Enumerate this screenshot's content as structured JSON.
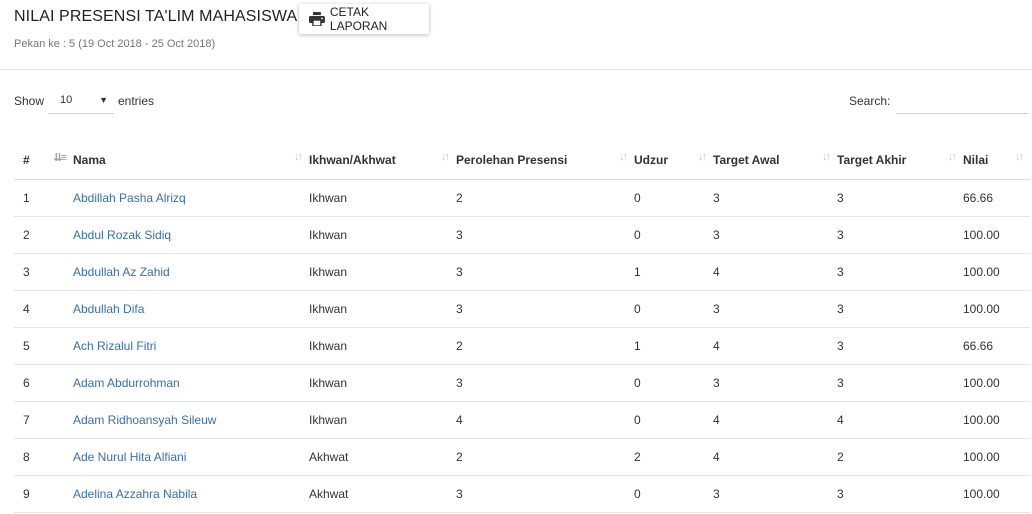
{
  "header": {
    "title": "NILAI PRESENSI TA'LIM MAHASISWA",
    "print_button": "CETAK LAPORAN",
    "print_icon": "printer-icon",
    "subtitle": "Pekan ke : 5 (19 Oct 2018 - 25 Oct 2018)"
  },
  "controls": {
    "show_label": "Show",
    "length_value": "10",
    "entries_label": "entries",
    "search_label": "Search:",
    "search_value": ""
  },
  "table": {
    "columns": [
      "#",
      "Nama",
      "Ikhwan/Akhwat",
      "Perolehan Presensi",
      "Udzur",
      "Target Awal",
      "Target Akhir",
      "Nilai"
    ],
    "sort_icon": "sort-arrows-icon",
    "rows": [
      [
        "1",
        "Abdillah Pasha Alrizq",
        "Ikhwan",
        "2",
        "0",
        "3",
        "3",
        "66.66"
      ],
      [
        "2",
        "Abdul Rozak Sidiq",
        "Ikhwan",
        "3",
        "0",
        "3",
        "3",
        "100.00"
      ],
      [
        "3",
        "Abdullah Az Zahid",
        "Ikhwan",
        "3",
        "1",
        "4",
        "3",
        "100.00"
      ],
      [
        "4",
        "Abdullah Difa",
        "Ikhwan",
        "3",
        "0",
        "3",
        "3",
        "100.00"
      ],
      [
        "5",
        "Ach Rizalul Fitri",
        "Ikhwan",
        "2",
        "1",
        "4",
        "3",
        "66.66"
      ],
      [
        "6",
        "Adam Abdurrohman",
        "Ikhwan",
        "3",
        "0",
        "3",
        "3",
        "100.00"
      ],
      [
        "7",
        "Adam Ridhoansyah Sileuw",
        "Ikhwan",
        "4",
        "0",
        "4",
        "4",
        "100.00"
      ],
      [
        "8",
        "Ade Nurul Hita Alfiani",
        "Akhwat",
        "2",
        "2",
        "4",
        "2",
        "100.00"
      ],
      [
        "9",
        "Adelina Azzahra Nabila",
        "Akhwat",
        "3",
        "0",
        "3",
        "3",
        "100.00"
      ]
    ]
  },
  "colors": {
    "link": "#3a6fa8",
    "text": "#333333",
    "border": "#e4e4e4"
  }
}
